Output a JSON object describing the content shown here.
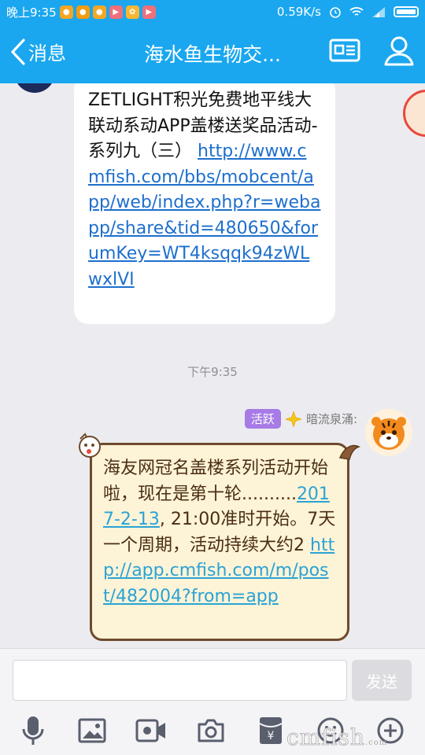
{
  "status_bar": {
    "time": "晚上9:35",
    "speed": "0.59K/s"
  },
  "header": {
    "back_label": "消息",
    "title": "海水鱼生物交..."
  },
  "messages": {
    "incoming": {
      "text": "ZETLIGHT积光免费地平线大联动系动APP盖楼送奖品活动-系列九（三）",
      "link": "http://www.cmfish.com/bbs/mobcent/app/web/index.php?r=webapp/share&tid=480650&forumKey=WT4ksqqk94zWLwxlVI"
    },
    "timestamp": "下午9:35",
    "outgoing": {
      "badge": "活跃",
      "sender": "暗流泉涌:",
      "text_before": "海友网冠名盖楼系列活动开始啦，现在是第十轮..........",
      "date_link": "2017-2-13",
      "text_after": ", 21:00准时开始。7天一个周期，活动持续大约2 ",
      "link": "http://app.cmfish.com/m/post/482004?from=app"
    }
  },
  "input_bar": {
    "placeholder": "",
    "send_label": "发送"
  },
  "watermark": "cmfish",
  "watermark_sub": ".com",
  "colors": {
    "header_bg": "#1aa7ef",
    "link": "#1e6fcd",
    "outgoing_bubble": "#fdf3d6",
    "badge": "#a77be6"
  }
}
